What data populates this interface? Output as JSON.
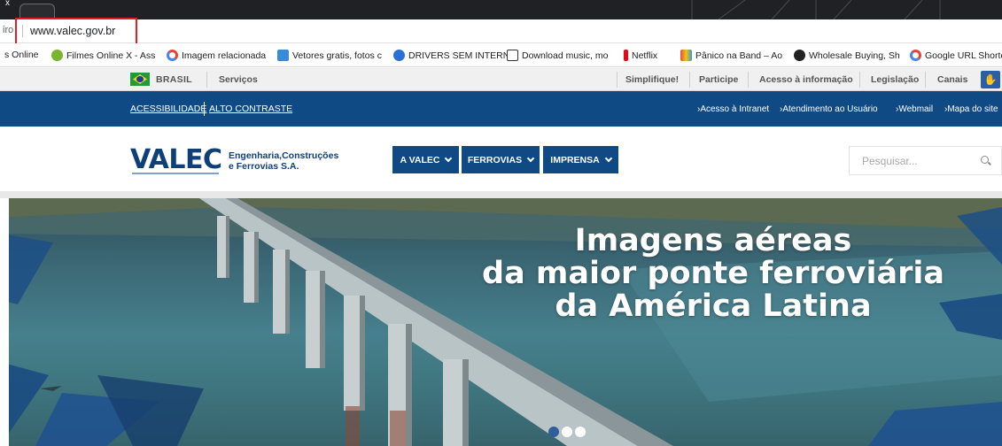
{
  "browser": {
    "tab_close": "x",
    "address_left": "iro",
    "url": "www.valec.gov.br"
  },
  "bookmarks": [
    {
      "label": "s Online",
      "icon": "none"
    },
    {
      "label": "Filmes Online X - Ass",
      "icon": "film-icon"
    },
    {
      "label": "Imagem relacionada",
      "icon": "google-icon"
    },
    {
      "label": "Vetores gratis, fotos c",
      "icon": "vector-icon"
    },
    {
      "label": "DRIVERS SEM INTERN",
      "icon": "driver-icon"
    },
    {
      "label": "Download music, mo",
      "icon": "download-icon"
    },
    {
      "label": "Netflix",
      "icon": "netflix-icon"
    },
    {
      "label": "Pânico na Band – Ao",
      "icon": "band-icon"
    },
    {
      "label": "Wholesale Buying, Sh",
      "icon": "wholesale-icon"
    },
    {
      "label": "Google URL Shorten",
      "icon": "google-icon"
    }
  ],
  "govbar": {
    "brasil": "BRASIL",
    "servicos": "Serviços",
    "links": [
      "Simplifique!",
      "Participe",
      "Acesso à informação",
      "Legislação",
      "Canais"
    ]
  },
  "bluebar": {
    "acessibilidade": "ACESSIBILIDADE",
    "alto_contraste": "ALTO CONTRASTE",
    "links": [
      "›Acesso à Intranet",
      "›Atendimento ao Usuário",
      "›Webmail",
      "›Mapa do site"
    ]
  },
  "header": {
    "logo": "VALEC",
    "logo_sub1": "Engenharia,Construções",
    "logo_sub2": "e Ferrovias S.A.",
    "nav": [
      "A VALEC",
      "FERROVIAS",
      "IMPRENSA"
    ],
    "search_placeholder": "Pesquisar..."
  },
  "hero": {
    "line1": "Imagens aéreas",
    "line2": "da maior ponte ferroviária",
    "line3": "da América Latina",
    "slides_total": 3,
    "active_slide": 2
  },
  "colors": {
    "primary_blue": "#0f4a84",
    "logo_blue": "#0f3f78",
    "highlight_red": "#e02020"
  }
}
